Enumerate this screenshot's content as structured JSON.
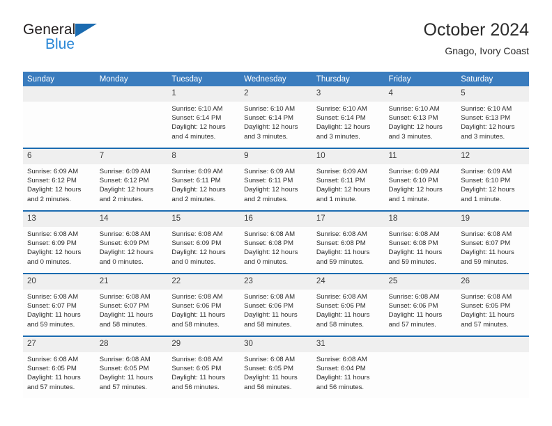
{
  "brand": {
    "name_line1": "General",
    "name_line2": "Blue",
    "logo_icon": "triangle-flag-icon"
  },
  "header": {
    "title": "October 2024",
    "subtitle": "Gnago, Ivory Coast"
  },
  "calendar": {
    "weekday_headers": [
      "Sunday",
      "Monday",
      "Tuesday",
      "Wednesday",
      "Thursday",
      "Friday",
      "Saturday"
    ],
    "accent_color": "#3a7cbe",
    "rule_color": "#1b6bb0",
    "daynum_bg": "#efefef",
    "weeks": [
      [
        {
          "day": "",
          "empty": true
        },
        {
          "day": "",
          "empty": true
        },
        {
          "day": "1",
          "sunrise": "Sunrise: 6:10 AM",
          "sunset": "Sunset: 6:14 PM",
          "daylight_line1": "Daylight: 12 hours",
          "daylight_line2": "and 4 minutes."
        },
        {
          "day": "2",
          "sunrise": "Sunrise: 6:10 AM",
          "sunset": "Sunset: 6:14 PM",
          "daylight_line1": "Daylight: 12 hours",
          "daylight_line2": "and 3 minutes."
        },
        {
          "day": "3",
          "sunrise": "Sunrise: 6:10 AM",
          "sunset": "Sunset: 6:14 PM",
          "daylight_line1": "Daylight: 12 hours",
          "daylight_line2": "and 3 minutes."
        },
        {
          "day": "4",
          "sunrise": "Sunrise: 6:10 AM",
          "sunset": "Sunset: 6:13 PM",
          "daylight_line1": "Daylight: 12 hours",
          "daylight_line2": "and 3 minutes."
        },
        {
          "day": "5",
          "sunrise": "Sunrise: 6:10 AM",
          "sunset": "Sunset: 6:13 PM",
          "daylight_line1": "Daylight: 12 hours",
          "daylight_line2": "and 3 minutes."
        }
      ],
      [
        {
          "day": "6",
          "sunrise": "Sunrise: 6:09 AM",
          "sunset": "Sunset: 6:12 PM",
          "daylight_line1": "Daylight: 12 hours",
          "daylight_line2": "and 2 minutes."
        },
        {
          "day": "7",
          "sunrise": "Sunrise: 6:09 AM",
          "sunset": "Sunset: 6:12 PM",
          "daylight_line1": "Daylight: 12 hours",
          "daylight_line2": "and 2 minutes."
        },
        {
          "day": "8",
          "sunrise": "Sunrise: 6:09 AM",
          "sunset": "Sunset: 6:11 PM",
          "daylight_line1": "Daylight: 12 hours",
          "daylight_line2": "and 2 minutes."
        },
        {
          "day": "9",
          "sunrise": "Sunrise: 6:09 AM",
          "sunset": "Sunset: 6:11 PM",
          "daylight_line1": "Daylight: 12 hours",
          "daylight_line2": "and 2 minutes."
        },
        {
          "day": "10",
          "sunrise": "Sunrise: 6:09 AM",
          "sunset": "Sunset: 6:11 PM",
          "daylight_line1": "Daylight: 12 hours",
          "daylight_line2": "and 1 minute."
        },
        {
          "day": "11",
          "sunrise": "Sunrise: 6:09 AM",
          "sunset": "Sunset: 6:10 PM",
          "daylight_line1": "Daylight: 12 hours",
          "daylight_line2": "and 1 minute."
        },
        {
          "day": "12",
          "sunrise": "Sunrise: 6:09 AM",
          "sunset": "Sunset: 6:10 PM",
          "daylight_line1": "Daylight: 12 hours",
          "daylight_line2": "and 1 minute."
        }
      ],
      [
        {
          "day": "13",
          "sunrise": "Sunrise: 6:08 AM",
          "sunset": "Sunset: 6:09 PM",
          "daylight_line1": "Daylight: 12 hours",
          "daylight_line2": "and 0 minutes."
        },
        {
          "day": "14",
          "sunrise": "Sunrise: 6:08 AM",
          "sunset": "Sunset: 6:09 PM",
          "daylight_line1": "Daylight: 12 hours",
          "daylight_line2": "and 0 minutes."
        },
        {
          "day": "15",
          "sunrise": "Sunrise: 6:08 AM",
          "sunset": "Sunset: 6:09 PM",
          "daylight_line1": "Daylight: 12 hours",
          "daylight_line2": "and 0 minutes."
        },
        {
          "day": "16",
          "sunrise": "Sunrise: 6:08 AM",
          "sunset": "Sunset: 6:08 PM",
          "daylight_line1": "Daylight: 12 hours",
          "daylight_line2": "and 0 minutes."
        },
        {
          "day": "17",
          "sunrise": "Sunrise: 6:08 AM",
          "sunset": "Sunset: 6:08 PM",
          "daylight_line1": "Daylight: 11 hours",
          "daylight_line2": "and 59 minutes."
        },
        {
          "day": "18",
          "sunrise": "Sunrise: 6:08 AM",
          "sunset": "Sunset: 6:08 PM",
          "daylight_line1": "Daylight: 11 hours",
          "daylight_line2": "and 59 minutes."
        },
        {
          "day": "19",
          "sunrise": "Sunrise: 6:08 AM",
          "sunset": "Sunset: 6:07 PM",
          "daylight_line1": "Daylight: 11 hours",
          "daylight_line2": "and 59 minutes."
        }
      ],
      [
        {
          "day": "20",
          "sunrise": "Sunrise: 6:08 AM",
          "sunset": "Sunset: 6:07 PM",
          "daylight_line1": "Daylight: 11 hours",
          "daylight_line2": "and 59 minutes."
        },
        {
          "day": "21",
          "sunrise": "Sunrise: 6:08 AM",
          "sunset": "Sunset: 6:07 PM",
          "daylight_line1": "Daylight: 11 hours",
          "daylight_line2": "and 58 minutes."
        },
        {
          "day": "22",
          "sunrise": "Sunrise: 6:08 AM",
          "sunset": "Sunset: 6:06 PM",
          "daylight_line1": "Daylight: 11 hours",
          "daylight_line2": "and 58 minutes."
        },
        {
          "day": "23",
          "sunrise": "Sunrise: 6:08 AM",
          "sunset": "Sunset: 6:06 PM",
          "daylight_line1": "Daylight: 11 hours",
          "daylight_line2": "and 58 minutes."
        },
        {
          "day": "24",
          "sunrise": "Sunrise: 6:08 AM",
          "sunset": "Sunset: 6:06 PM",
          "daylight_line1": "Daylight: 11 hours",
          "daylight_line2": "and 58 minutes."
        },
        {
          "day": "25",
          "sunrise": "Sunrise: 6:08 AM",
          "sunset": "Sunset: 6:06 PM",
          "daylight_line1": "Daylight: 11 hours",
          "daylight_line2": "and 57 minutes."
        },
        {
          "day": "26",
          "sunrise": "Sunrise: 6:08 AM",
          "sunset": "Sunset: 6:05 PM",
          "daylight_line1": "Daylight: 11 hours",
          "daylight_line2": "and 57 minutes."
        }
      ],
      [
        {
          "day": "27",
          "sunrise": "Sunrise: 6:08 AM",
          "sunset": "Sunset: 6:05 PM",
          "daylight_line1": "Daylight: 11 hours",
          "daylight_line2": "and 57 minutes."
        },
        {
          "day": "28",
          "sunrise": "Sunrise: 6:08 AM",
          "sunset": "Sunset: 6:05 PM",
          "daylight_line1": "Daylight: 11 hours",
          "daylight_line2": "and 57 minutes."
        },
        {
          "day": "29",
          "sunrise": "Sunrise: 6:08 AM",
          "sunset": "Sunset: 6:05 PM",
          "daylight_line1": "Daylight: 11 hours",
          "daylight_line2": "and 56 minutes."
        },
        {
          "day": "30",
          "sunrise": "Sunrise: 6:08 AM",
          "sunset": "Sunset: 6:05 PM",
          "daylight_line1": "Daylight: 11 hours",
          "daylight_line2": "and 56 minutes."
        },
        {
          "day": "31",
          "sunrise": "Sunrise: 6:08 AM",
          "sunset": "Sunset: 6:04 PM",
          "daylight_line1": "Daylight: 11 hours",
          "daylight_line2": "and 56 minutes."
        },
        {
          "day": "",
          "empty": true
        },
        {
          "day": "",
          "empty": true
        }
      ]
    ]
  }
}
